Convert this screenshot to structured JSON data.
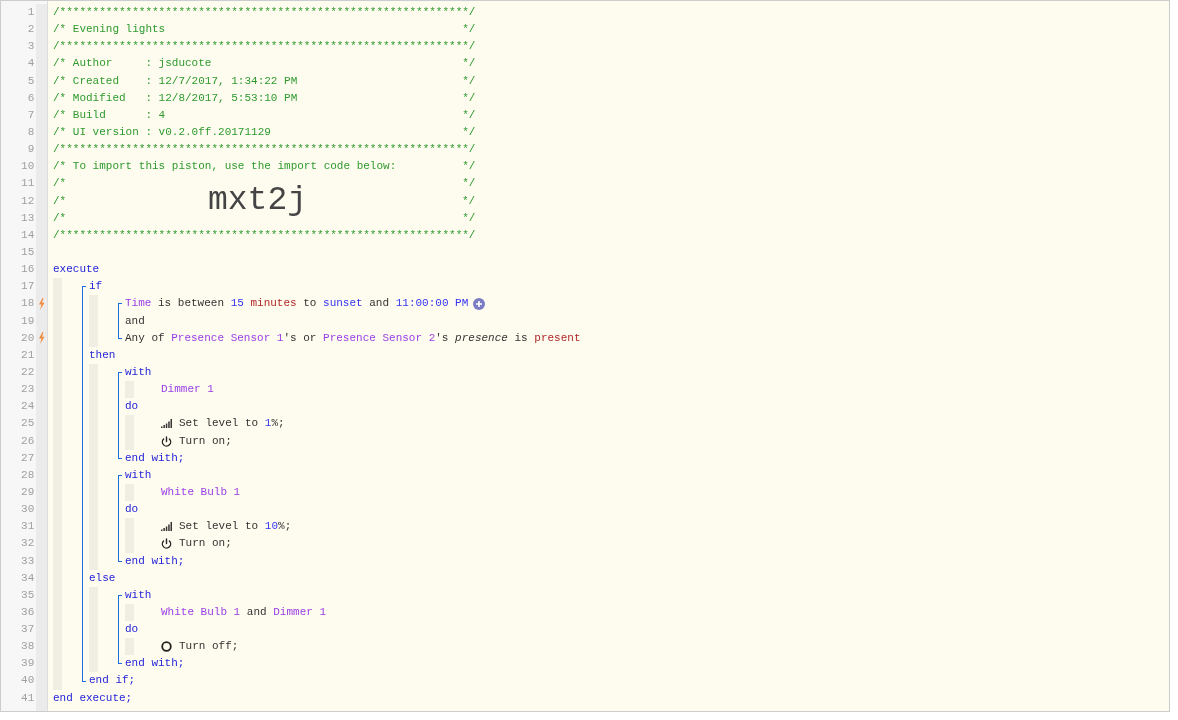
{
  "code": [
    {
      "n": "1",
      "trigger": false,
      "kind": "rule",
      "text": "/**************************************************************/"
    },
    {
      "n": "2",
      "trigger": false,
      "kind": "comment",
      "text": "/* Evening lights",
      "end": "*/"
    },
    {
      "n": "3",
      "trigger": false,
      "kind": "rule",
      "text": "/**************************************************************/"
    },
    {
      "n": "4",
      "trigger": false,
      "kind": "comment",
      "text": "/* Author     : jsducote",
      "end": "*/"
    },
    {
      "n": "5",
      "trigger": false,
      "kind": "comment",
      "text": "/* Created    : 12/7/2017, 1:34:22 PM",
      "end": "*/"
    },
    {
      "n": "6",
      "trigger": false,
      "kind": "comment",
      "text": "/* Modified   : 12/8/2017, 5:53:10 PM",
      "end": "*/"
    },
    {
      "n": "7",
      "trigger": false,
      "kind": "comment",
      "text": "/* Build      : 4",
      "end": "*/"
    },
    {
      "n": "8",
      "trigger": false,
      "kind": "comment",
      "text": "/* UI version : v0.2.0ff.20171129",
      "end": "*/"
    },
    {
      "n": "9",
      "trigger": false,
      "kind": "rule",
      "text": "/**************************************************************/"
    },
    {
      "n": "10",
      "trigger": false,
      "kind": "comment",
      "text": "/* To import this piston, use the import code below:",
      "end": "*/"
    },
    {
      "n": "11",
      "trigger": false,
      "kind": "comment",
      "text": "/*",
      "end": "*/"
    },
    {
      "n": "12",
      "trigger": false,
      "kind": "import",
      "text": "/*",
      "code": "mxt2j",
      "end": "*/"
    },
    {
      "n": "13",
      "trigger": false,
      "kind": "comment",
      "text": "/*",
      "end": "*/"
    },
    {
      "n": "14",
      "trigger": false,
      "kind": "rule",
      "text": "/**************************************************************/"
    },
    {
      "n": "15",
      "trigger": false,
      "kind": "blank"
    },
    {
      "n": "16",
      "trigger": false,
      "kind": "code",
      "tokens": [
        {
          "kind": "keyword",
          "text": "execute"
        }
      ]
    },
    {
      "kind": "block",
      "children": [
        {
          "kind": "bracket",
          "children": [
            {
              "n": "17",
              "trigger": false,
              "kind": "code",
              "tokens": [
                {
                  "kind": "keyword",
                  "text": "if"
                }
              ]
            },
            {
              "kind": "block",
              "children": [
                {
                  "kind": "bracket",
                  "children": [
                    {
                      "n": "18",
                      "trigger": true,
                      "kind": "code",
                      "addable": true,
                      "tokens": [
                        {
                          "kind": "device",
                          "text": "Time"
                        },
                        {
                          "kind": "text",
                          "text": " is between "
                        },
                        {
                          "kind": "value",
                          "text": "15 "
                        },
                        {
                          "kind": "unit",
                          "text": "minutes"
                        },
                        {
                          "kind": "text",
                          "text": " to "
                        },
                        {
                          "kind": "value",
                          "text": "sunset"
                        },
                        {
                          "kind": "text",
                          "text": " and "
                        },
                        {
                          "kind": "value",
                          "text": "11:00:00 PM"
                        }
                      ]
                    },
                    {
                      "n": "19",
                      "trigger": false,
                      "kind": "code",
                      "tokens": [
                        {
                          "kind": "text",
                          "text": "and"
                        }
                      ]
                    },
                    {
                      "n": "20",
                      "trigger": true,
                      "kind": "code",
                      "tokens": [
                        {
                          "kind": "text",
                          "text": "Any of "
                        },
                        {
                          "kind": "device",
                          "text": "Presence Sensor 1"
                        },
                        {
                          "kind": "text",
                          "text": "'s or "
                        },
                        {
                          "kind": "device",
                          "text": "Presence Sensor 2"
                        },
                        {
                          "kind": "text",
                          "text": "'s "
                        },
                        {
                          "kind": "italic",
                          "text": "presence"
                        },
                        {
                          "kind": "text",
                          "text": " is "
                        },
                        {
                          "kind": "unit",
                          "text": "present"
                        }
                      ]
                    }
                  ]
                }
              ]
            },
            {
              "n": "21",
              "trigger": false,
              "kind": "code",
              "tokens": [
                {
                  "kind": "keyword",
                  "text": "then"
                }
              ]
            },
            {
              "kind": "block",
              "children": [
                {
                  "kind": "bracket",
                  "children": [
                    {
                      "n": "22",
                      "trigger": false,
                      "kind": "code",
                      "tokens": [
                        {
                          "kind": "keyword",
                          "text": "with"
                        }
                      ]
                    },
                    {
                      "kind": "block",
                      "children": [
                        {
                          "n": "23",
                          "trigger": false,
                          "kind": "code",
                          "tokens": [
                            {
                              "kind": "device",
                              "text": "Dimmer 1"
                            }
                          ]
                        }
                      ]
                    },
                    {
                      "n": "24",
                      "trigger": false,
                      "kind": "code",
                      "tokens": [
                        {
                          "kind": "keyword",
                          "text": "do"
                        }
                      ]
                    },
                    {
                      "kind": "block",
                      "children": [
                        {
                          "n": "25",
                          "trigger": false,
                          "kind": "set_level",
                          "tokens": [
                            {
                              "kind": "text",
                              "text": "Set level to "
                            },
                            {
                              "kind": "value",
                              "text": "1"
                            },
                            {
                              "kind": "text",
                              "text": "%;"
                            }
                          ]
                        },
                        {
                          "n": "26",
                          "trigger": false,
                          "kind": "turn_on",
                          "tokens": [
                            {
                              "kind": "text",
                              "text": "Turn on;"
                            }
                          ]
                        }
                      ]
                    },
                    {
                      "n": "27",
                      "trigger": false,
                      "kind": "code",
                      "tokens": [
                        {
                          "kind": "keyword",
                          "text": "end with;"
                        }
                      ]
                    }
                  ]
                },
                {
                  "kind": "bracket",
                  "children": [
                    {
                      "n": "28",
                      "trigger": false,
                      "kind": "code",
                      "tokens": [
                        {
                          "kind": "keyword",
                          "text": "with"
                        }
                      ]
                    },
                    {
                      "kind": "block",
                      "children": [
                        {
                          "n": "29",
                          "trigger": false,
                          "kind": "code",
                          "tokens": [
                            {
                              "kind": "device",
                              "text": "White Bulb 1"
                            }
                          ]
                        }
                      ]
                    },
                    {
                      "n": "30",
                      "trigger": false,
                      "kind": "code",
                      "tokens": [
                        {
                          "kind": "keyword",
                          "text": "do"
                        }
                      ]
                    },
                    {
                      "kind": "block",
                      "children": [
                        {
                          "n": "31",
                          "trigger": false,
                          "kind": "set_level",
                          "tokens": [
                            {
                              "kind": "text",
                              "text": "Set level to "
                            },
                            {
                              "kind": "value",
                              "text": "10"
                            },
                            {
                              "kind": "text",
                              "text": "%;"
                            }
                          ]
                        },
                        {
                          "n": "32",
                          "trigger": false,
                          "kind": "turn_on",
                          "tokens": [
                            {
                              "kind": "text",
                              "text": "Turn on;"
                            }
                          ]
                        }
                      ]
                    },
                    {
                      "n": "33",
                      "trigger": false,
                      "kind": "code",
                      "tokens": [
                        {
                          "kind": "keyword",
                          "text": "end with;"
                        }
                      ]
                    }
                  ]
                }
              ]
            },
            {
              "n": "34",
              "trigger": false,
              "kind": "code",
              "tokens": [
                {
                  "kind": "keyword",
                  "text": "else"
                }
              ]
            },
            {
              "kind": "block",
              "children": [
                {
                  "kind": "bracket",
                  "children": [
                    {
                      "n": "35",
                      "trigger": false,
                      "kind": "code",
                      "tokens": [
                        {
                          "kind": "keyword",
                          "text": "with"
                        }
                      ]
                    },
                    {
                      "kind": "block",
                      "children": [
                        {
                          "n": "36",
                          "trigger": false,
                          "kind": "code",
                          "tokens": [
                            {
                              "kind": "device",
                              "text": "White Bulb 1"
                            },
                            {
                              "kind": "text",
                              "text": " and "
                            },
                            {
                              "kind": "device",
                              "text": "Dimmer 1"
                            }
                          ]
                        }
                      ]
                    },
                    {
                      "n": "37",
                      "trigger": false,
                      "kind": "code",
                      "tokens": [
                        {
                          "kind": "keyword",
                          "text": "do"
                        }
                      ]
                    },
                    {
                      "kind": "block",
                      "children": [
                        {
                          "n": "38",
                          "trigger": false,
                          "kind": "turn_off",
                          "tokens": [
                            {
                              "kind": "text",
                              "text": "Turn off;"
                            }
                          ]
                        }
                      ]
                    },
                    {
                      "n": "39",
                      "trigger": false,
                      "kind": "code",
                      "tokens": [
                        {
                          "kind": "keyword",
                          "text": "end with;"
                        }
                      ]
                    }
                  ]
                }
              ]
            },
            {
              "n": "40",
              "trigger": false,
              "kind": "code",
              "tokens": [
                {
                  "kind": "keyword",
                  "text": "end if;"
                }
              ]
            }
          ]
        }
      ]
    },
    {
      "n": "41",
      "trigger": false,
      "kind": "code",
      "tokens": [
        {
          "kind": "keyword",
          "text": "end execute;"
        }
      ]
    }
  ]
}
